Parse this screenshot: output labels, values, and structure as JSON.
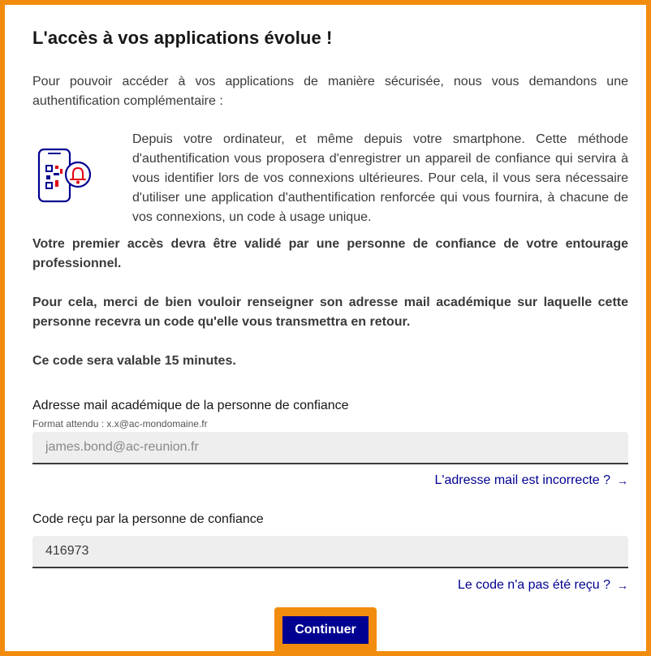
{
  "title": "L'accès à vos applications évolue !",
  "intro": "Pour pouvoir accéder à vos applications de manière sécurisée, nous vous demandons une authentification complémentaire :",
  "method_text": "Depuis votre ordinateur, et même depuis votre smartphone. Cette méthode d'authentification vous proposera d'enregistrer un appareil de confiance qui servira à vous identifier lors de vos connexions ultérieures. Pour cela, il vous sera nécessaire d'utiliser une application d'authentification renforcée qui vous fournira, à chacune de vos connexions, un code à usage unique.",
  "illustration_icon": "phone-qr-bell-icon",
  "paragraph_validation": "Votre premier accès devra être validé par une personne de confiance de votre entourage professionnel.",
  "paragraph_email_request": "Pour cela, merci de bien vouloir renseigner son adresse mail académique sur laquelle cette personne recevra un code qu'elle vous transmettra en retour.",
  "paragraph_validity": "Ce code sera valable 15 minutes.",
  "email_field": {
    "label": "Adresse mail académique de la personne de confiance",
    "hint": "Format attendu : x.x@ac-mondomaine.fr",
    "value": "",
    "placeholder": "james.bond@ac-reunion.fr"
  },
  "email_link": "L'adresse mail est incorrecte ?",
  "code_field": {
    "label": "Code reçu par la personne de confiance",
    "value": "416973",
    "placeholder": ""
  },
  "code_link": "Le code n'a pas été reçu ?",
  "link_arrow": "→",
  "submit_label": "Continuer",
  "colors": {
    "frame_border": "#f28c0f",
    "primary": "#000091",
    "accent_red": "#e1000f",
    "input_bg": "#eeeeee"
  }
}
